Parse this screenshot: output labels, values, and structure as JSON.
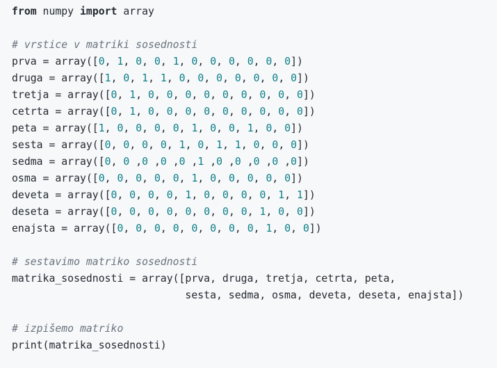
{
  "code": {
    "lines": [
      [
        {
          "t": "kw",
          "v": "from"
        },
        {
          "t": "pl",
          "v": " numpy "
        },
        {
          "t": "kw",
          "v": "import"
        },
        {
          "t": "pl",
          "v": " array"
        }
      ],
      [],
      [
        {
          "t": "cm",
          "v": "# vrstice v matriki sosednosti"
        }
      ],
      [
        {
          "t": "pl",
          "v": "prva = array(["
        },
        {
          "t": "num",
          "v": "0"
        },
        {
          "t": "pl",
          "v": ", "
        },
        {
          "t": "num",
          "v": "1"
        },
        {
          "t": "pl",
          "v": ", "
        },
        {
          "t": "num",
          "v": "0"
        },
        {
          "t": "pl",
          "v": ", "
        },
        {
          "t": "num",
          "v": "0"
        },
        {
          "t": "pl",
          "v": ", "
        },
        {
          "t": "num",
          "v": "1"
        },
        {
          "t": "pl",
          "v": ", "
        },
        {
          "t": "num",
          "v": "0"
        },
        {
          "t": "pl",
          "v": ", "
        },
        {
          "t": "num",
          "v": "0"
        },
        {
          "t": "pl",
          "v": ", "
        },
        {
          "t": "num",
          "v": "0"
        },
        {
          "t": "pl",
          "v": ", "
        },
        {
          "t": "num",
          "v": "0"
        },
        {
          "t": "pl",
          "v": ", "
        },
        {
          "t": "num",
          "v": "0"
        },
        {
          "t": "pl",
          "v": ", "
        },
        {
          "t": "num",
          "v": "0"
        },
        {
          "t": "pl",
          "v": "])"
        }
      ],
      [
        {
          "t": "pl",
          "v": "druga = array(["
        },
        {
          "t": "num",
          "v": "1"
        },
        {
          "t": "pl",
          "v": ", "
        },
        {
          "t": "num",
          "v": "0"
        },
        {
          "t": "pl",
          "v": ", "
        },
        {
          "t": "num",
          "v": "1"
        },
        {
          "t": "pl",
          "v": ", "
        },
        {
          "t": "num",
          "v": "1"
        },
        {
          "t": "pl",
          "v": ", "
        },
        {
          "t": "num",
          "v": "0"
        },
        {
          "t": "pl",
          "v": ", "
        },
        {
          "t": "num",
          "v": "0"
        },
        {
          "t": "pl",
          "v": ", "
        },
        {
          "t": "num",
          "v": "0"
        },
        {
          "t": "pl",
          "v": ", "
        },
        {
          "t": "num",
          "v": "0"
        },
        {
          "t": "pl",
          "v": ", "
        },
        {
          "t": "num",
          "v": "0"
        },
        {
          "t": "pl",
          "v": ", "
        },
        {
          "t": "num",
          "v": "0"
        },
        {
          "t": "pl",
          "v": ", "
        },
        {
          "t": "num",
          "v": "0"
        },
        {
          "t": "pl",
          "v": "])"
        }
      ],
      [
        {
          "t": "pl",
          "v": "tretja = array(["
        },
        {
          "t": "num",
          "v": "0"
        },
        {
          "t": "pl",
          "v": ", "
        },
        {
          "t": "num",
          "v": "1"
        },
        {
          "t": "pl",
          "v": ", "
        },
        {
          "t": "num",
          "v": "0"
        },
        {
          "t": "pl",
          "v": ", "
        },
        {
          "t": "num",
          "v": "0"
        },
        {
          "t": "pl",
          "v": ", "
        },
        {
          "t": "num",
          "v": "0"
        },
        {
          "t": "pl",
          "v": ", "
        },
        {
          "t": "num",
          "v": "0"
        },
        {
          "t": "pl",
          "v": ", "
        },
        {
          "t": "num",
          "v": "0"
        },
        {
          "t": "pl",
          "v": ", "
        },
        {
          "t": "num",
          "v": "0"
        },
        {
          "t": "pl",
          "v": ", "
        },
        {
          "t": "num",
          "v": "0"
        },
        {
          "t": "pl",
          "v": ", "
        },
        {
          "t": "num",
          "v": "0"
        },
        {
          "t": "pl",
          "v": ", "
        },
        {
          "t": "num",
          "v": "0"
        },
        {
          "t": "pl",
          "v": "])"
        }
      ],
      [
        {
          "t": "pl",
          "v": "cetrta = array(["
        },
        {
          "t": "num",
          "v": "0"
        },
        {
          "t": "pl",
          "v": ", "
        },
        {
          "t": "num",
          "v": "1"
        },
        {
          "t": "pl",
          "v": ", "
        },
        {
          "t": "num",
          "v": "0"
        },
        {
          "t": "pl",
          "v": ", "
        },
        {
          "t": "num",
          "v": "0"
        },
        {
          "t": "pl",
          "v": ", "
        },
        {
          "t": "num",
          "v": "0"
        },
        {
          "t": "pl",
          "v": ", "
        },
        {
          "t": "num",
          "v": "0"
        },
        {
          "t": "pl",
          "v": ", "
        },
        {
          "t": "num",
          "v": "0"
        },
        {
          "t": "pl",
          "v": ", "
        },
        {
          "t": "num",
          "v": "0"
        },
        {
          "t": "pl",
          "v": ", "
        },
        {
          "t": "num",
          "v": "0"
        },
        {
          "t": "pl",
          "v": ", "
        },
        {
          "t": "num",
          "v": "0"
        },
        {
          "t": "pl",
          "v": ", "
        },
        {
          "t": "num",
          "v": "0"
        },
        {
          "t": "pl",
          "v": "])"
        }
      ],
      [
        {
          "t": "pl",
          "v": "peta = array(["
        },
        {
          "t": "num",
          "v": "1"
        },
        {
          "t": "pl",
          "v": ", "
        },
        {
          "t": "num",
          "v": "0"
        },
        {
          "t": "pl",
          "v": ", "
        },
        {
          "t": "num",
          "v": "0"
        },
        {
          "t": "pl",
          "v": ", "
        },
        {
          "t": "num",
          "v": "0"
        },
        {
          "t": "pl",
          "v": ", "
        },
        {
          "t": "num",
          "v": "0"
        },
        {
          "t": "pl",
          "v": ", "
        },
        {
          "t": "num",
          "v": "1"
        },
        {
          "t": "pl",
          "v": ", "
        },
        {
          "t": "num",
          "v": "0"
        },
        {
          "t": "pl",
          "v": ", "
        },
        {
          "t": "num",
          "v": "0"
        },
        {
          "t": "pl",
          "v": ", "
        },
        {
          "t": "num",
          "v": "1"
        },
        {
          "t": "pl",
          "v": ", "
        },
        {
          "t": "num",
          "v": "0"
        },
        {
          "t": "pl",
          "v": ", "
        },
        {
          "t": "num",
          "v": "0"
        },
        {
          "t": "pl",
          "v": "])"
        }
      ],
      [
        {
          "t": "pl",
          "v": "sesta = array(["
        },
        {
          "t": "num",
          "v": "0"
        },
        {
          "t": "pl",
          "v": ", "
        },
        {
          "t": "num",
          "v": "0"
        },
        {
          "t": "pl",
          "v": ", "
        },
        {
          "t": "num",
          "v": "0"
        },
        {
          "t": "pl",
          "v": ", "
        },
        {
          "t": "num",
          "v": "0"
        },
        {
          "t": "pl",
          "v": ", "
        },
        {
          "t": "num",
          "v": "1"
        },
        {
          "t": "pl",
          "v": ", "
        },
        {
          "t": "num",
          "v": "0"
        },
        {
          "t": "pl",
          "v": ", "
        },
        {
          "t": "num",
          "v": "1"
        },
        {
          "t": "pl",
          "v": ", "
        },
        {
          "t": "num",
          "v": "1"
        },
        {
          "t": "pl",
          "v": ", "
        },
        {
          "t": "num",
          "v": "0"
        },
        {
          "t": "pl",
          "v": ", "
        },
        {
          "t": "num",
          "v": "0"
        },
        {
          "t": "pl",
          "v": ", "
        },
        {
          "t": "num",
          "v": "0"
        },
        {
          "t": "pl",
          "v": "])"
        }
      ],
      [
        {
          "t": "pl",
          "v": "sedma = array(["
        },
        {
          "t": "num",
          "v": "0"
        },
        {
          "t": "pl",
          "v": ", "
        },
        {
          "t": "num",
          "v": "0"
        },
        {
          "t": "pl",
          "v": " ,"
        },
        {
          "t": "num",
          "v": "0"
        },
        {
          "t": "pl",
          "v": " ,"
        },
        {
          "t": "num",
          "v": "0"
        },
        {
          "t": "pl",
          "v": " ,"
        },
        {
          "t": "num",
          "v": "0"
        },
        {
          "t": "pl",
          "v": " ,"
        },
        {
          "t": "num",
          "v": "1"
        },
        {
          "t": "pl",
          "v": " ,"
        },
        {
          "t": "num",
          "v": "0"
        },
        {
          "t": "pl",
          "v": " ,"
        },
        {
          "t": "num",
          "v": "0"
        },
        {
          "t": "pl",
          "v": " ,"
        },
        {
          "t": "num",
          "v": "0"
        },
        {
          "t": "pl",
          "v": " ,"
        },
        {
          "t": "num",
          "v": "0"
        },
        {
          "t": "pl",
          "v": " ,"
        },
        {
          "t": "num",
          "v": "0"
        },
        {
          "t": "pl",
          "v": "])"
        }
      ],
      [
        {
          "t": "pl",
          "v": "osma = array(["
        },
        {
          "t": "num",
          "v": "0"
        },
        {
          "t": "pl",
          "v": ", "
        },
        {
          "t": "num",
          "v": "0"
        },
        {
          "t": "pl",
          "v": ", "
        },
        {
          "t": "num",
          "v": "0"
        },
        {
          "t": "pl",
          "v": ", "
        },
        {
          "t": "num",
          "v": "0"
        },
        {
          "t": "pl",
          "v": ", "
        },
        {
          "t": "num",
          "v": "0"
        },
        {
          "t": "pl",
          "v": ", "
        },
        {
          "t": "num",
          "v": "1"
        },
        {
          "t": "pl",
          "v": ", "
        },
        {
          "t": "num",
          "v": "0"
        },
        {
          "t": "pl",
          "v": ", "
        },
        {
          "t": "num",
          "v": "0"
        },
        {
          "t": "pl",
          "v": ", "
        },
        {
          "t": "num",
          "v": "0"
        },
        {
          "t": "pl",
          "v": ", "
        },
        {
          "t": "num",
          "v": "0"
        },
        {
          "t": "pl",
          "v": ", "
        },
        {
          "t": "num",
          "v": "0"
        },
        {
          "t": "pl",
          "v": "])"
        }
      ],
      [
        {
          "t": "pl",
          "v": "deveta = array(["
        },
        {
          "t": "num",
          "v": "0"
        },
        {
          "t": "pl",
          "v": ", "
        },
        {
          "t": "num",
          "v": "0"
        },
        {
          "t": "pl",
          "v": ", "
        },
        {
          "t": "num",
          "v": "0"
        },
        {
          "t": "pl",
          "v": ", "
        },
        {
          "t": "num",
          "v": "0"
        },
        {
          "t": "pl",
          "v": ", "
        },
        {
          "t": "num",
          "v": "1"
        },
        {
          "t": "pl",
          "v": ", "
        },
        {
          "t": "num",
          "v": "0"
        },
        {
          "t": "pl",
          "v": ", "
        },
        {
          "t": "num",
          "v": "0"
        },
        {
          "t": "pl",
          "v": ", "
        },
        {
          "t": "num",
          "v": "0"
        },
        {
          "t": "pl",
          "v": ", "
        },
        {
          "t": "num",
          "v": "0"
        },
        {
          "t": "pl",
          "v": ", "
        },
        {
          "t": "num",
          "v": "1"
        },
        {
          "t": "pl",
          "v": ", "
        },
        {
          "t": "num",
          "v": "1"
        },
        {
          "t": "pl",
          "v": "])"
        }
      ],
      [
        {
          "t": "pl",
          "v": "deseta = array(["
        },
        {
          "t": "num",
          "v": "0"
        },
        {
          "t": "pl",
          "v": ", "
        },
        {
          "t": "num",
          "v": "0"
        },
        {
          "t": "pl",
          "v": ", "
        },
        {
          "t": "num",
          "v": "0"
        },
        {
          "t": "pl",
          "v": ", "
        },
        {
          "t": "num",
          "v": "0"
        },
        {
          "t": "pl",
          "v": ", "
        },
        {
          "t": "num",
          "v": "0"
        },
        {
          "t": "pl",
          "v": ", "
        },
        {
          "t": "num",
          "v": "0"
        },
        {
          "t": "pl",
          "v": ", "
        },
        {
          "t": "num",
          "v": "0"
        },
        {
          "t": "pl",
          "v": ", "
        },
        {
          "t": "num",
          "v": "0"
        },
        {
          "t": "pl",
          "v": ", "
        },
        {
          "t": "num",
          "v": "1"
        },
        {
          "t": "pl",
          "v": ", "
        },
        {
          "t": "num",
          "v": "0"
        },
        {
          "t": "pl",
          "v": ", "
        },
        {
          "t": "num",
          "v": "0"
        },
        {
          "t": "pl",
          "v": "])"
        }
      ],
      [
        {
          "t": "pl",
          "v": "enajsta = array(["
        },
        {
          "t": "num",
          "v": "0"
        },
        {
          "t": "pl",
          "v": ", "
        },
        {
          "t": "num",
          "v": "0"
        },
        {
          "t": "pl",
          "v": ", "
        },
        {
          "t": "num",
          "v": "0"
        },
        {
          "t": "pl",
          "v": ", "
        },
        {
          "t": "num",
          "v": "0"
        },
        {
          "t": "pl",
          "v": ", "
        },
        {
          "t": "num",
          "v": "0"
        },
        {
          "t": "pl",
          "v": ", "
        },
        {
          "t": "num",
          "v": "0"
        },
        {
          "t": "pl",
          "v": ", "
        },
        {
          "t": "num",
          "v": "0"
        },
        {
          "t": "pl",
          "v": ", "
        },
        {
          "t": "num",
          "v": "0"
        },
        {
          "t": "pl",
          "v": ", "
        },
        {
          "t": "num",
          "v": "1"
        },
        {
          "t": "pl",
          "v": ", "
        },
        {
          "t": "num",
          "v": "0"
        },
        {
          "t": "pl",
          "v": ", "
        },
        {
          "t": "num",
          "v": "0"
        },
        {
          "t": "pl",
          "v": "])"
        }
      ],
      [],
      [
        {
          "t": "cm",
          "v": "# sestavimo matriko sosednosti"
        }
      ],
      [
        {
          "t": "pl",
          "v": "matrika_sosednosti = array([prva, druga, tretja, cetrta, peta,"
        }
      ],
      [
        {
          "t": "pl",
          "v": "                            sesta, sedma, osma, deveta, deseta, enajsta])"
        }
      ],
      [],
      [
        {
          "t": "cm",
          "v": "# izpišemo matriko"
        }
      ],
      [
        {
          "t": "pl",
          "v": "print(matrika_sosednosti)"
        }
      ]
    ]
  },
  "colors": {
    "background": "#f6f8fa",
    "text": "#24292f",
    "comment": "#6a737d",
    "number": "#0b7e87"
  }
}
